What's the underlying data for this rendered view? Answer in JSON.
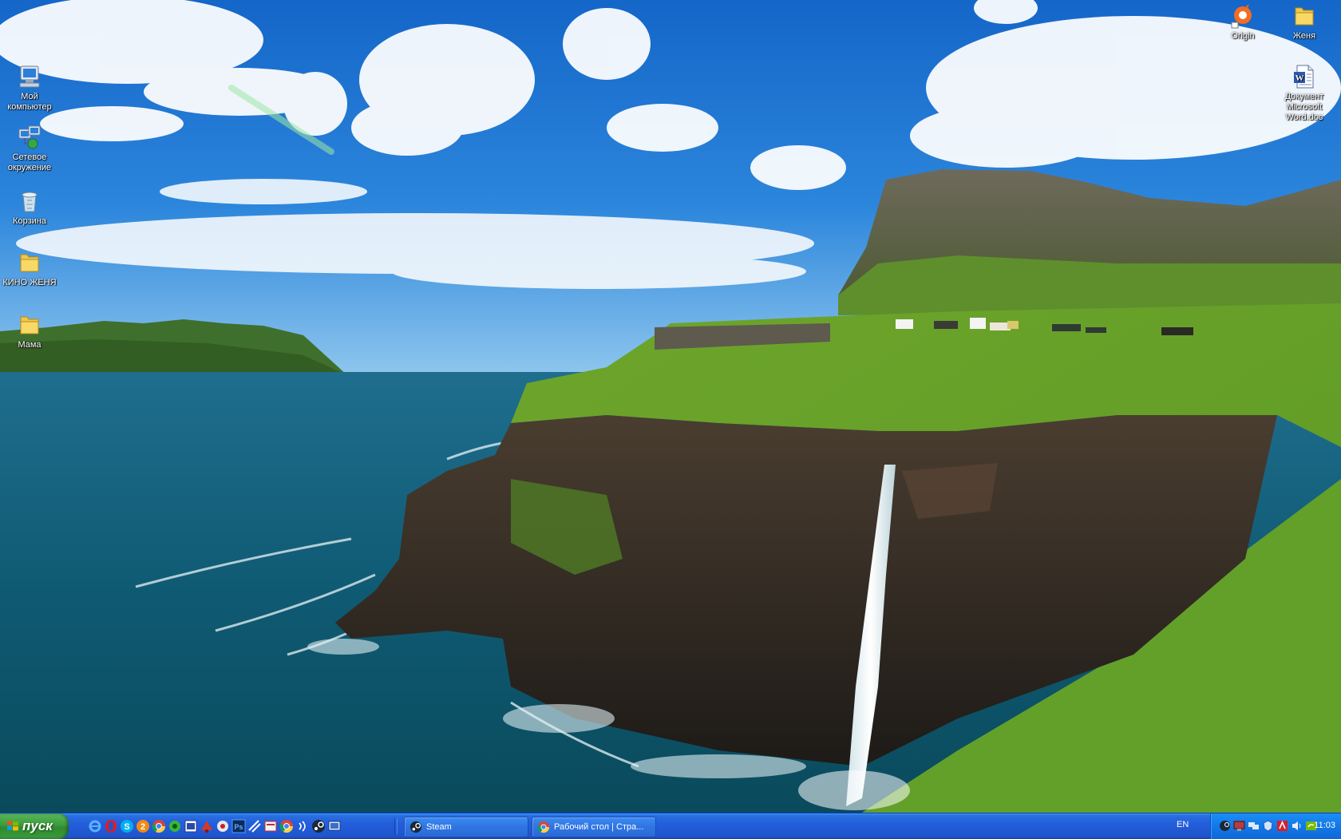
{
  "desktop": {
    "left_icons": [
      {
        "label": "Мой компьютер",
        "icon": "computer-icon"
      },
      {
        "label": "Сетевое окружение",
        "icon": "network-icon"
      },
      {
        "label": "Корзина",
        "icon": "recycle-bin-icon"
      },
      {
        "label": "КИНО ЖЕНЯ",
        "icon": "folder-icon"
      },
      {
        "label": "Мама",
        "icon": "folder-icon"
      }
    ],
    "right_icons": [
      {
        "label": "Origin",
        "icon": "origin-icon"
      },
      {
        "label": "Женя",
        "icon": "folder-icon"
      },
      {
        "label": "Документ Microsoft Word.doc",
        "icon": "word-document-icon"
      }
    ]
  },
  "taskbar": {
    "start_label": "пуск",
    "quick_launch": [
      "internet-explorer-icon",
      "opera-icon",
      "skype-icon",
      "odnoklassniki-icon",
      "chrome-icon",
      "gear-app-icon",
      "calendar-app-icon",
      "antivirus-icon",
      "media-app-icon",
      "photoshop-icon",
      "arrow-app-icon",
      "document-app-icon",
      "chrome-icon",
      "audio-app-icon",
      "steam-icon",
      "show-desktop-icon"
    ],
    "tasks": [
      {
        "label": "Steam",
        "icon": "steam-icon"
      },
      {
        "label": "Рабочий стол | Стра...",
        "icon": "chrome-icon"
      }
    ],
    "language": "EN",
    "clock": "11:03",
    "tray_icons": [
      "steam-tray-icon",
      "monitor-tray-icon",
      "network-tray-icon",
      "security-tray-icon",
      "antivirus-tray-icon",
      "volume-tray-icon",
      "nvidia-tray-icon"
    ]
  },
  "colors": {
    "taskbar_blue": "#245edb",
    "start_green": "#3c9c3c",
    "tray_blue": "#1378e8"
  }
}
